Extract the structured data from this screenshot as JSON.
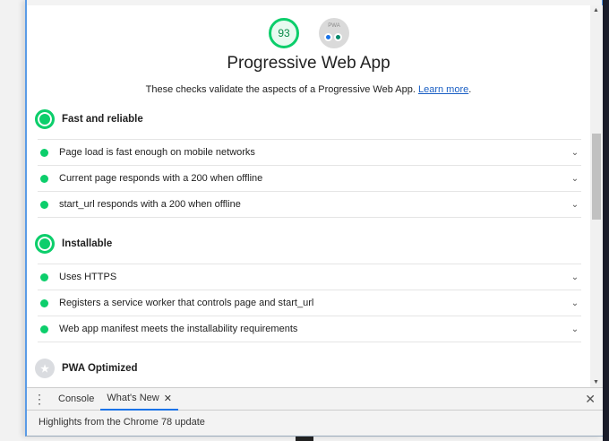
{
  "gauges": {
    "performance_score": "93",
    "pwa_label": "PWA"
  },
  "category": {
    "title": "Progressive Web App",
    "description": "These checks validate the aspects of a Progressive Web App.",
    "learn_more": "Learn more",
    "period": "."
  },
  "groups": [
    {
      "title": "Fast and reliable",
      "audits": [
        "Page load is fast enough on mobile networks",
        "Current page responds with a 200 when offline",
        "start_url responds with a 200 when offline"
      ]
    },
    {
      "title": "Installable",
      "audits": [
        "Uses HTTPS",
        "Registers a service worker that controls page and start_url",
        "Web app manifest meets the installability requirements"
      ]
    },
    {
      "title": "PWA Optimized",
      "audits": []
    }
  ],
  "drawer": {
    "tabs": [
      "Console",
      "What's New"
    ],
    "active_tab": "What's New",
    "highlight": "Highlights from the Chrome 78 update"
  },
  "colors": {
    "pass": "#0cce6b",
    "link": "#1a5fc4",
    "tab_active": "#1a73e8"
  }
}
